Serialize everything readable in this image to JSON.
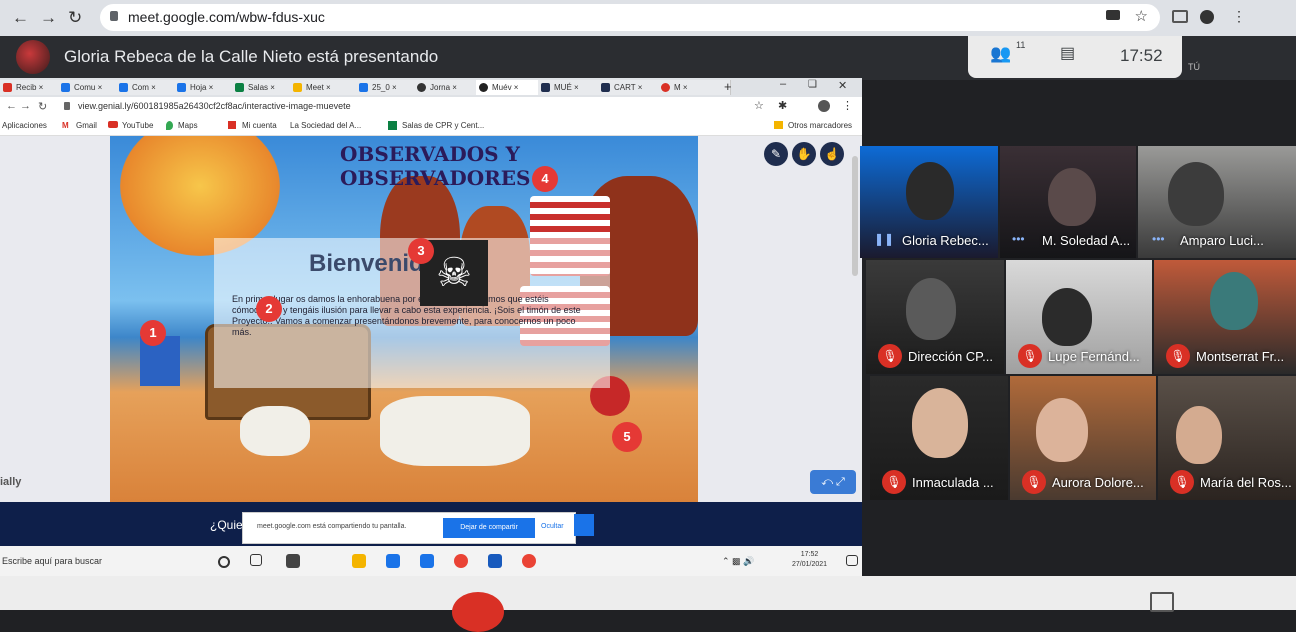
{
  "browser": {
    "url": "meet.google.com/wbw-fdus-xuc"
  },
  "meet": {
    "presenting_text": "Gloria Rebeca de la Calle Nieto está presentando",
    "participants_count": "11",
    "time": "17:52",
    "you_label": "TÚ"
  },
  "shared": {
    "tabs": [
      "Recib",
      "Comu",
      "Com",
      "Hoja",
      "Salas",
      "Meet",
      "25_0",
      "Jorna",
      "Muév",
      "MUÉ",
      "CART",
      "M"
    ],
    "url": "view.genial.ly/600181985a26430cf2cf8ac/interactive-image-muevete",
    "bookmarks": [
      "Aplicaciones",
      "Gmail",
      "YouTube",
      "Maps",
      "Mi cuenta",
      "La Sociedad del A...",
      "Salas de CPR y Cent...",
      "Otros marcadores"
    ],
    "scene_title": "OBSERVADOS Y OBSERVADORES",
    "welcome_title": "Bienvenidos/as",
    "welcome_text": "En primer lugar os damos la enhorabuena por estar aquí. Queremos que estéis cómodos/as y tengáis ilusión para llevar a cabo esta experiencia. ¡Sois el timón de este Proyecto!. Vamos a comenzar presentándonos brevemente, para conocernos un poco más.",
    "markers": [
      "1",
      "2",
      "3",
      "4",
      "5"
    ],
    "genially_label": "ially",
    "bottom_question": "¿Quie",
    "share_msg": "meet.google.com está compartiendo tu pantalla.",
    "stop_btn": "Dejar de compartir",
    "hide_btn": "Ocultar",
    "taskbar_search": "Escribe aquí para buscar",
    "clock_time": "17:52",
    "clock_date": "27/01/2021"
  },
  "participants": [
    {
      "name": "Gloria Rebec...",
      "state": "speaking"
    },
    {
      "name": "M. Soledad A...",
      "state": "on"
    },
    {
      "name": "Amparo Luci...",
      "state": "on"
    },
    {
      "name": "Dirección CP...",
      "state": "muted"
    },
    {
      "name": "Lupe Fernánd...",
      "state": "muted"
    },
    {
      "name": "Montserrat Fr...",
      "state": "muted"
    },
    {
      "name": "Inmaculada ...",
      "state": "muted"
    },
    {
      "name": "Aurora Dolore...",
      "state": "muted"
    },
    {
      "name": "María del Ros...",
      "state": "muted"
    }
  ],
  "colors": {
    "mute": "#d93025",
    "meet_bg": "#202124",
    "accent": "#1a73e8"
  }
}
